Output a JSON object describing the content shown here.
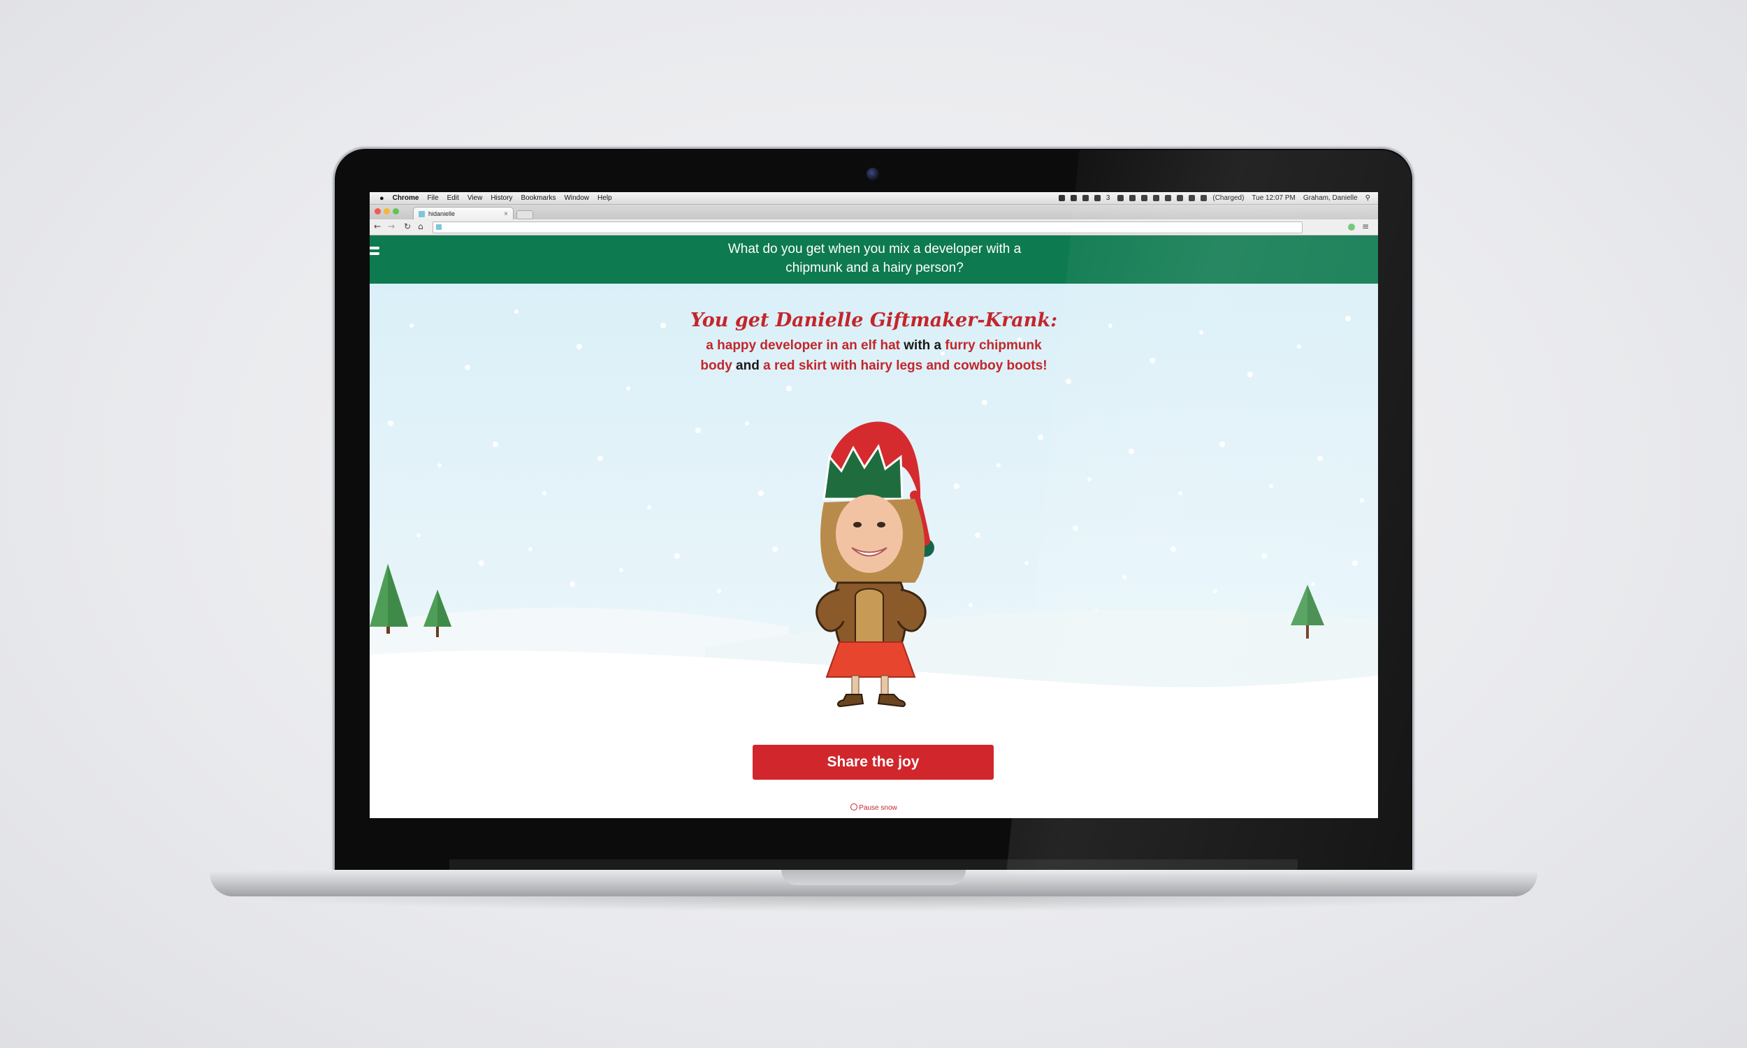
{
  "menubar": {
    "app_name": "Chrome",
    "menus": [
      "File",
      "Edit",
      "View",
      "History",
      "Bookmarks",
      "Window",
      "Help"
    ],
    "tray_text": "3",
    "battery": "(Charged)",
    "clock": "Tue 12:07 PM",
    "user": "Graham, Danielle"
  },
  "browser": {
    "tab_title": "hidanielle",
    "url": ""
  },
  "page": {
    "question": "What do you get when you mix a developer with a chipmunk and a hairy person?",
    "headline": "You get Danielle Giftmaker-Krank:",
    "description": {
      "part1": "a happy developer in an elf hat",
      "conj1": " with a ",
      "part2": "furry chipmunk body",
      "conj2": " and ",
      "part3": "a red skirt with hairy legs and cowboy boots!"
    },
    "share_button": "Share the joy",
    "pause_snow": "Pause snow"
  },
  "colors": {
    "banner": "#0e7a50",
    "accent_red": "#d1262c",
    "sky": "#d8eff8"
  }
}
